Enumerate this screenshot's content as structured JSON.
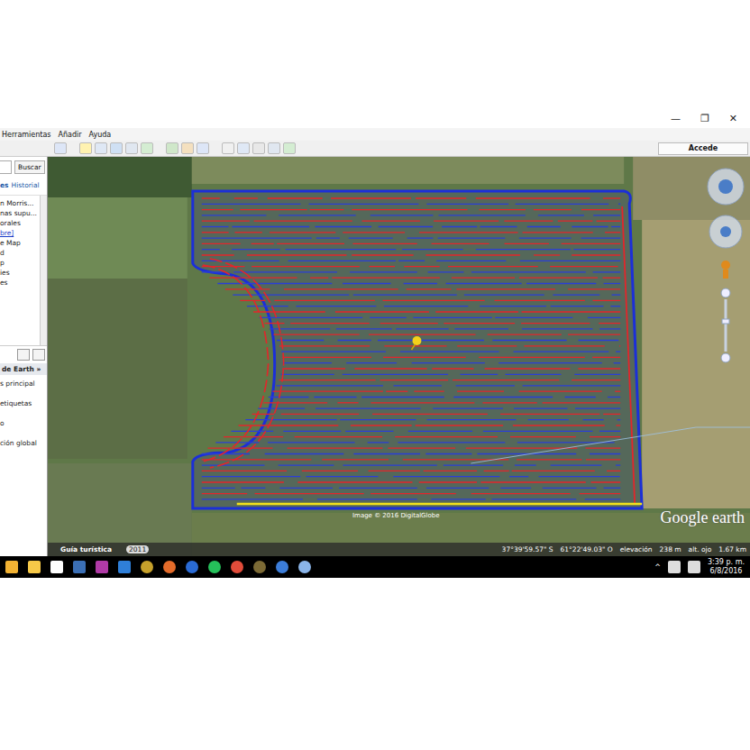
{
  "window": {
    "controls": [
      "—",
      "❐",
      "✕"
    ]
  },
  "menu": [
    {
      "label": "Herramientas"
    },
    {
      "label": "Añadir"
    },
    {
      "label": "Ayuda"
    }
  ],
  "toolbar": {
    "account_button": "Accede"
  },
  "sidebar": {
    "search_button": "Buscar",
    "tabs": [
      {
        "label": "es",
        "selected": true
      },
      {
        "label": "Historial",
        "selected": false
      }
    ],
    "places": [
      {
        "label": "n Morris...",
        "link": false
      },
      {
        "label": "nas supu...",
        "link": false
      },
      {
        "label": "orales",
        "link": false
      },
      {
        "label": "bre]",
        "link": true
      },
      {
        "label": "e Map",
        "link": false
      },
      {
        "label": "d",
        "link": false
      },
      {
        "label": "p",
        "link": false
      },
      {
        "label": "ies",
        "link": false
      },
      {
        "label": "es",
        "link": false
      }
    ],
    "layers_header": "de Earth »",
    "layers": [
      "s principal",
      "etiquetas",
      "o",
      "ción global"
    ]
  },
  "map": {
    "credit": "Image © 2016 DigitalGlobe",
    "logo": "Google earth",
    "status": {
      "tour": "Guía turística",
      "year": "2011",
      "lat": "37°39'59.57\" S",
      "lon": "61°22'49.03\" O",
      "elevation_label": "elevación",
      "elevation": "238 m",
      "eye_label": "alt. ojo",
      "eye": "1.67 km"
    }
  },
  "taskbar": {
    "tray_arrow": "^",
    "time": "3:39 p. m.",
    "date": "6/8/2016"
  }
}
